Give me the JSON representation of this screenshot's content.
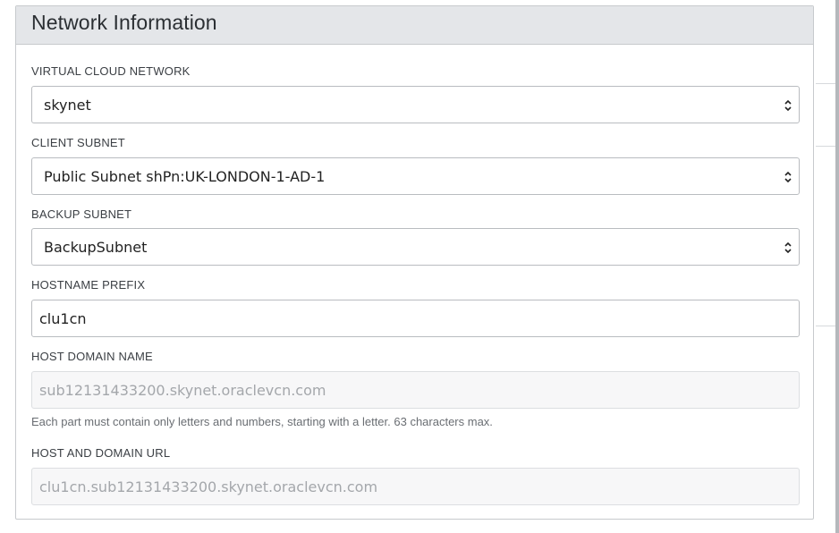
{
  "panel": {
    "title": "Network Information"
  },
  "fields": {
    "vcn": {
      "label": "VIRTUAL CLOUD NETWORK",
      "value": "skynet"
    },
    "client_subnet": {
      "label": "CLIENT SUBNET",
      "value": "Public Subnet shPn:UK-LONDON-1-AD-1"
    },
    "backup_subnet": {
      "label": "BACKUP SUBNET",
      "value": "BackupSubnet"
    },
    "hostname_prefix": {
      "label": "HOSTNAME PREFIX",
      "value": "clu1cn"
    },
    "host_domain_name": {
      "label": "HOST DOMAIN NAME",
      "value": "sub12131433200.skynet.oraclevcn.com",
      "help": "Each part must contain only letters and numbers, starting with a letter. 63 characters max."
    },
    "host_domain_url": {
      "label": "HOST AND DOMAIN URL",
      "value": "clu1cn.sub12131433200.skynet.oraclevcn.com"
    }
  },
  "icons": {
    "select_arrows": "chevron-up-down-icon"
  }
}
